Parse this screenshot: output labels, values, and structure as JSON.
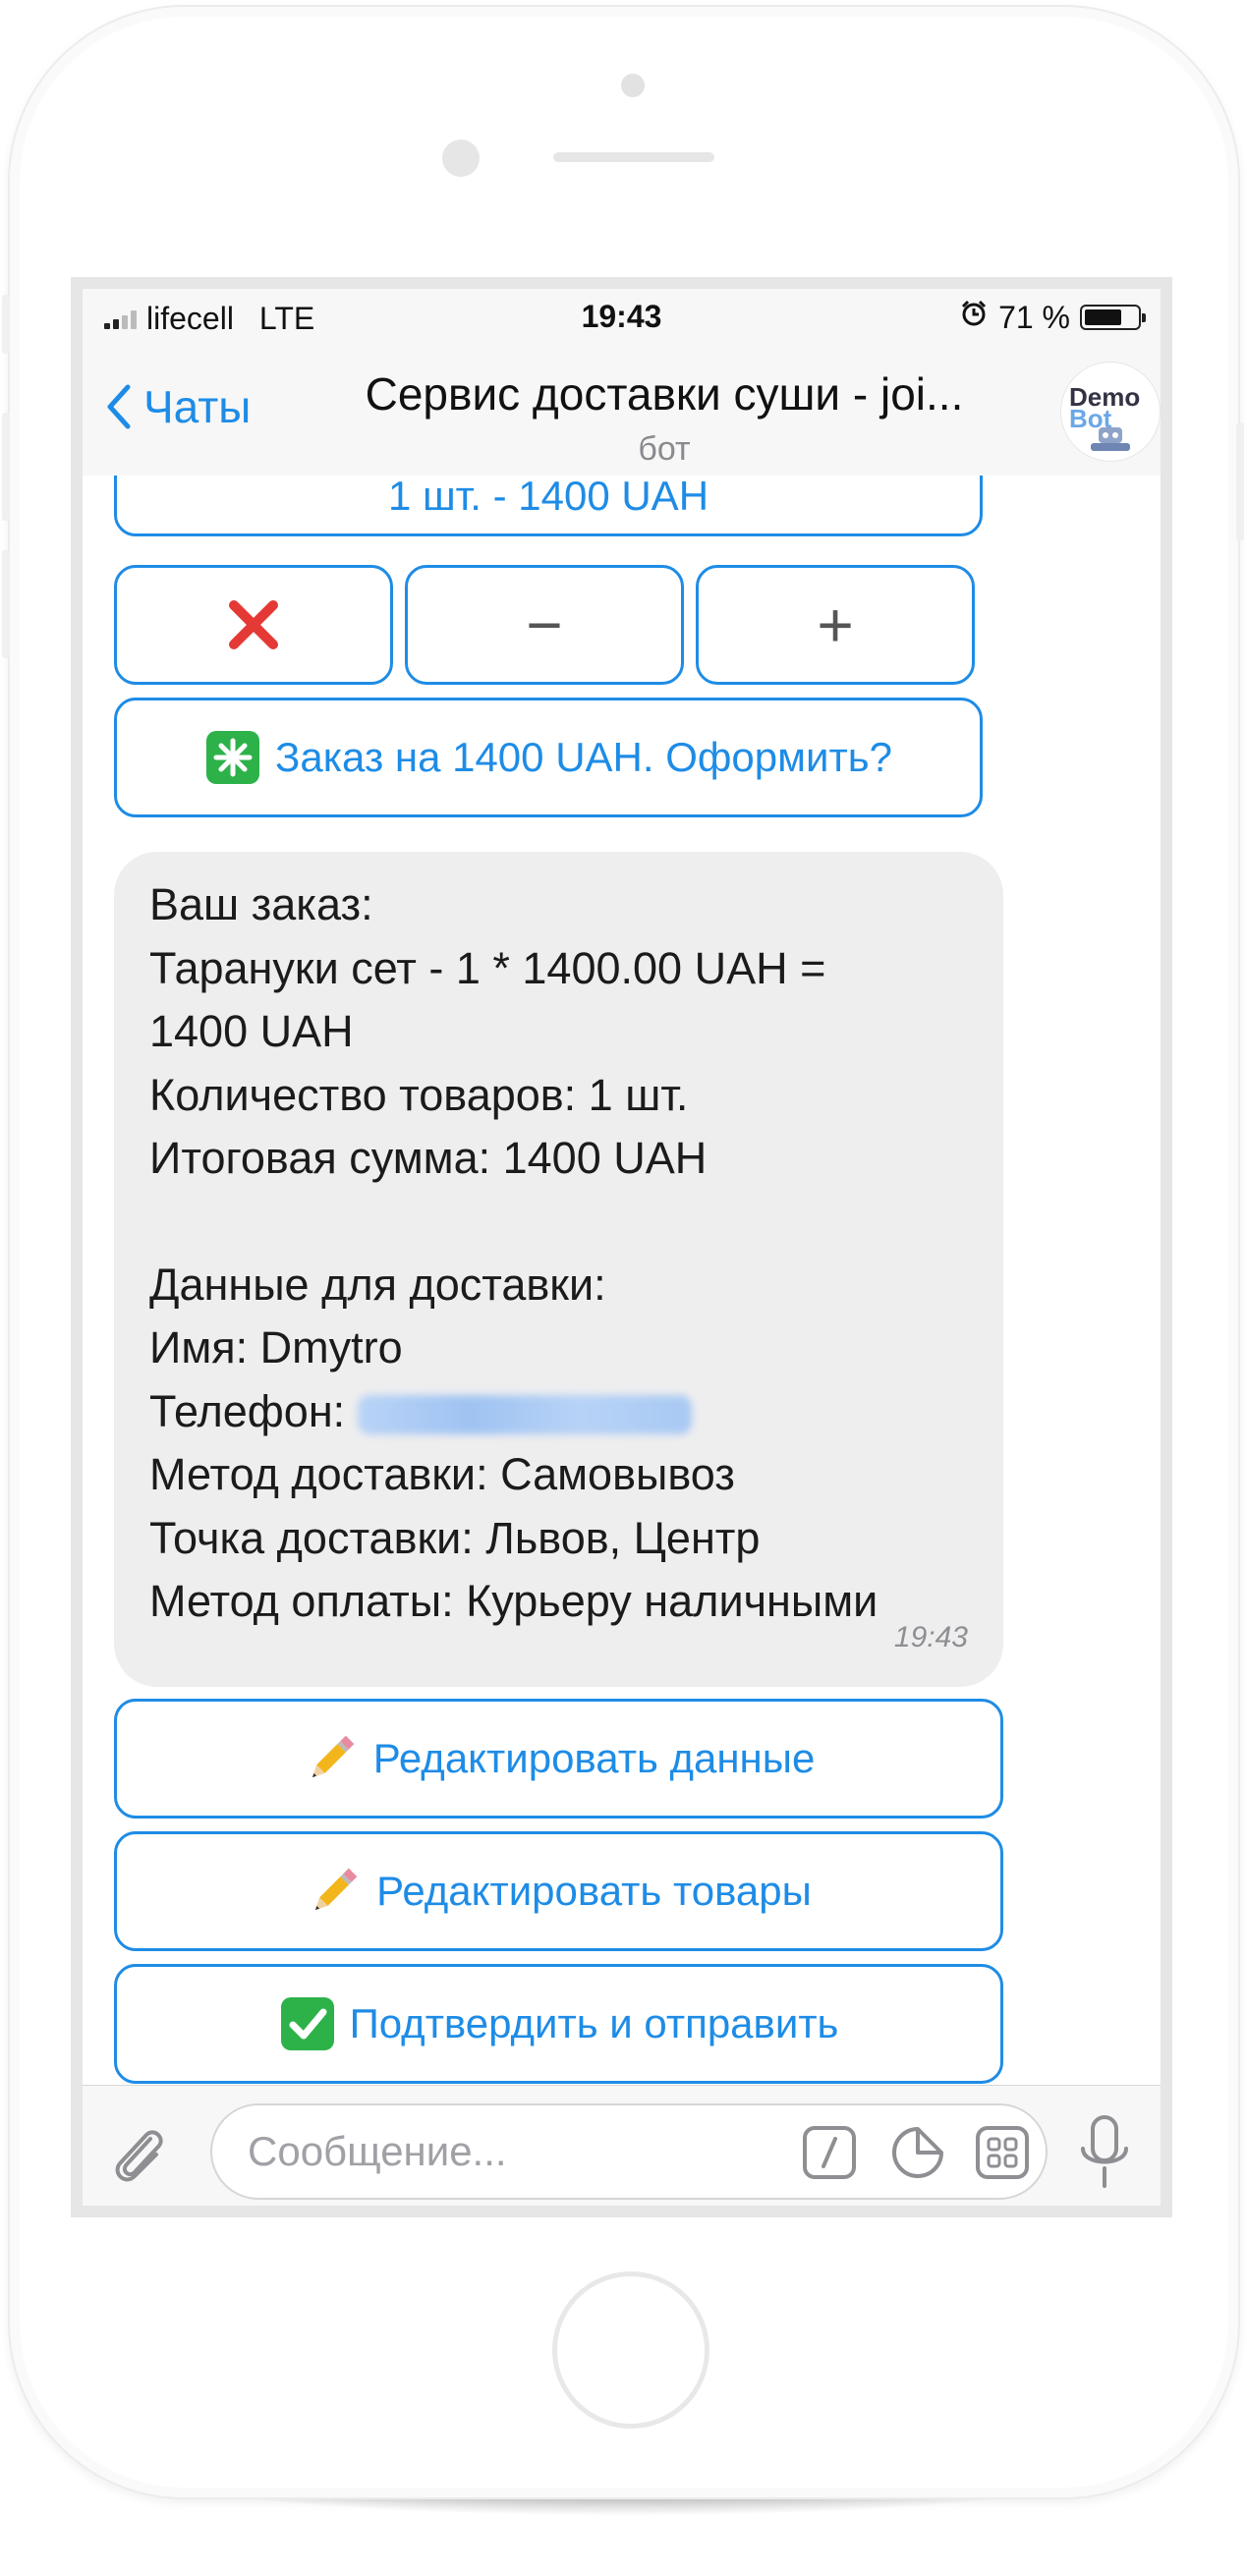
{
  "status": {
    "carrier": "lifecell",
    "network": "LTE",
    "time": "19:43",
    "battery_text": "71 %",
    "battery_level": 0.71
  },
  "nav": {
    "back_label": "Чаты",
    "title": "Сервис доставки суши - joi...",
    "subtitle": "бот",
    "avatar_line1": "Demo",
    "avatar_line2": "Bot"
  },
  "top_keyboard": {
    "item_button": "1 шт. - 1400 UAH",
    "remove_icon": "cross-mark-icon",
    "minus_label": "−",
    "plus_label": "+",
    "order_button": "Заказ на 1400 UAH. Оформить?"
  },
  "message": {
    "lines": [
      "Ваш заказ:",
      "Тарануки сет - 1 * 1400.00 UAH =",
      "1400 UAH",
      "Количество товаров: 1 шт.",
      "Итоговая сумма: 1400 UAH",
      "",
      "Данные для доставки:",
      "Имя: Dmytro",
      "Телефон: ",
      "Метод доставки: Самовывоз",
      "Точка доставки: Львов, Центр",
      "Метод оплаты: Курьеру наличными"
    ],
    "time": "19:43"
  },
  "bottom_keyboard": {
    "edit_data": "Редактировать данные",
    "edit_goods": "Редактировать товары",
    "confirm": "Подтвердить и отправить"
  },
  "input": {
    "placeholder": "Сообщение..."
  },
  "colors": {
    "accent": "#1e8ce6",
    "bubble": "#eeeeef",
    "cross": "#e53935",
    "check": "#2db24a"
  }
}
